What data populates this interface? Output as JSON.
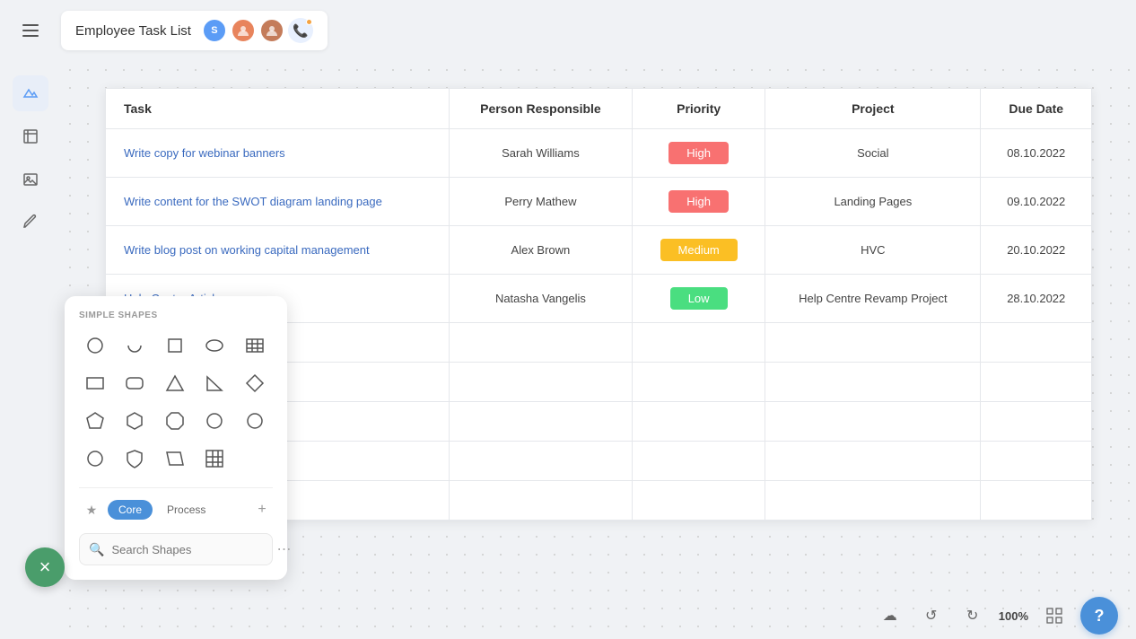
{
  "topbar": {
    "menu_label": "menu",
    "title": "Employee Task List",
    "avatar_s_label": "S",
    "avatars": [
      {
        "id": "s",
        "label": "S",
        "color": "#5b9cf6"
      },
      {
        "id": "p1",
        "label": "",
        "color": "#e8845c"
      },
      {
        "id": "p2",
        "label": "",
        "color": "#c47c5a"
      }
    ]
  },
  "table": {
    "headers": [
      "Task",
      "Person Responsible",
      "Priority",
      "Project",
      "Due Date"
    ],
    "rows": [
      {
        "task": "Write copy for webinar banners",
        "person": "Sarah Williams",
        "priority": "High",
        "priority_class": "priority-high",
        "project": "Social",
        "due_date": "08.10.2022"
      },
      {
        "task": "Write content for the SWOT diagram landing page",
        "person": "Perry Mathew",
        "priority": "High",
        "priority_class": "priority-high",
        "project": "Landing Pages",
        "due_date": "09.10.2022"
      },
      {
        "task": "Write blog post on working capital management",
        "person": "Alex Brown",
        "priority": "Medium",
        "priority_class": "priority-medium",
        "project": "HVC",
        "due_date": "20.10.2022"
      },
      {
        "task": "Help Centre Articles",
        "person": "Natasha Vangelis",
        "priority": "Low",
        "priority_class": "priority-low",
        "project": "Help Centre Revamp Project",
        "due_date": "28.10.2022"
      }
    ],
    "empty_rows": 5
  },
  "shapes_panel": {
    "section_label": "SIMPLE SHAPES",
    "tabs": [
      {
        "label": "Core",
        "active": true
      },
      {
        "label": "Process",
        "active": false
      }
    ],
    "search_placeholder": "Search Shapes"
  },
  "bottom_bar": {
    "zoom": "100%",
    "help_label": "?"
  },
  "fab": {
    "label": "×"
  }
}
